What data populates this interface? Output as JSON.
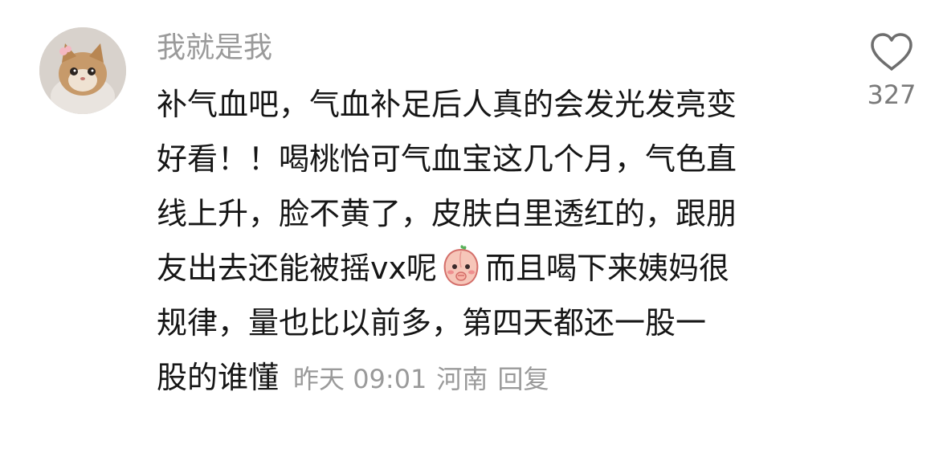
{
  "comment": {
    "username": "我就是我",
    "lines": [
      "补气血吧，气血补足后人真的会发光发亮变",
      "好看！！喝桃怡可气血宝这几个月，气色直",
      "线上升，脸不黄了，皮肤白里透红的，跟朋",
      "友出去还能被摇vx呢",
      "而且喝下来姨妈很",
      "规律，量也比以前多，第四天都还一股一",
      "股的谁懂"
    ],
    "time": "昨天 09:01",
    "location": "河南",
    "reply_label": "回复",
    "like_count": "327",
    "emoji": "peach-emoji"
  },
  "colors": {
    "text": "#161616",
    "secondary": "#9a9a9a",
    "icon": "#7a7a7a"
  }
}
